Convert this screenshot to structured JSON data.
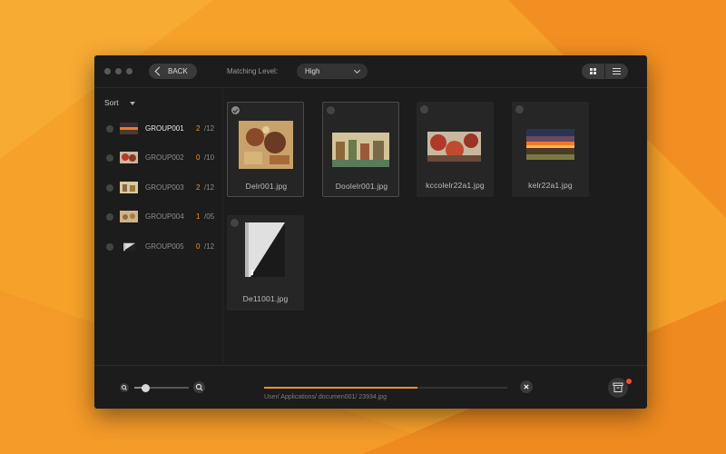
{
  "colors": {
    "background_orange": "#f6a22a",
    "accent_orange": "#f0922a",
    "window_bg": "#1c1c1c",
    "notification_red": "#ff4a2f"
  },
  "toolbar": {
    "back_label": "BACK",
    "matching_label": "Matching Level:",
    "matching_value": "High",
    "view_modes": [
      "grid-icon",
      "list-icon"
    ]
  },
  "sidebar": {
    "sort_label": "Sort",
    "groups": [
      {
        "name": "GROUP001",
        "count": "2",
        "total": "/12",
        "active": true,
        "thumb": "sunset-thumbnail"
      },
      {
        "name": "GROUP002",
        "count": "0",
        "total": "/10",
        "active": false,
        "thumb": "red-mural-thumbnail"
      },
      {
        "name": "GROUP003",
        "count": "2",
        "total": "/12",
        "active": false,
        "thumb": "mural-thumbnail"
      },
      {
        "name": "GROUP004",
        "count": "1",
        "total": "/05",
        "active": false,
        "thumb": "mural-thumbnail"
      },
      {
        "name": "GROUP005",
        "count": "0",
        "total": "/12",
        "active": false,
        "thumb": "document-thumbnail"
      }
    ]
  },
  "files": [
    {
      "name": "Delr001.jpg",
      "selected": true,
      "checked": true
    },
    {
      "name": "Doolelr001.jpg",
      "selected": true,
      "checked": false
    },
    {
      "name": "kccolelr22a1.jpg",
      "selected": false,
      "checked": false
    },
    {
      "name": "kelr22a1.jpg",
      "selected": false,
      "checked": false
    },
    {
      "name": "De11001.jpg",
      "selected": false,
      "checked": false
    }
  ],
  "footer": {
    "zoom_level": 0.2,
    "progress": 0.63,
    "path": "User/ Applications/ documen001/ 23934.jpg"
  }
}
